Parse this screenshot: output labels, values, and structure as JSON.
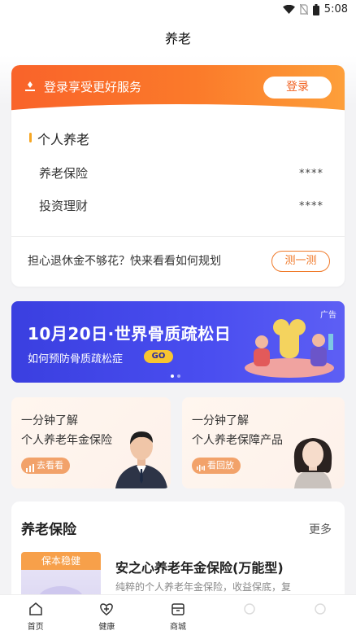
{
  "status_bar": {
    "time": "5:08"
  },
  "header": {
    "title": "养老"
  },
  "login": {
    "text": "登录享受更好服务",
    "button": "登录"
  },
  "personal": {
    "title": "个人养老",
    "rows": [
      {
        "label": "养老保险",
        "value": "****"
      },
      {
        "label": "投资理财",
        "value": "****"
      }
    ],
    "worry_text": "担心退休金不够花？快来看看如何规划",
    "test_button": "测一测"
  },
  "banner": {
    "title": "10月20日·世界骨质疏松日",
    "subtitle": "如何预防骨质疏松症",
    "go": "GO",
    "ad": "广告"
  },
  "cards": [
    {
      "line1": "一分钟了解",
      "line2": "个人养老年金保险",
      "button": "去看看",
      "icon": "bar-chart-icon"
    },
    {
      "line1": "一分钟了解",
      "line2": "个人养老保障产品",
      "button": "看回放",
      "icon": "sound-wave-icon"
    }
  ],
  "insurance": {
    "title": "养老保险",
    "more": "更多",
    "tag": "保本稳健",
    "product_name": "安之心养老年金保险(万能型)",
    "product_desc": "纯粹的个人养老年金保险，收益保底，复"
  },
  "nav": [
    {
      "label": "首页",
      "icon": "home-icon"
    },
    {
      "label": "健康",
      "icon": "health-icon"
    },
    {
      "label": "商城",
      "icon": "shop-icon"
    },
    {
      "label": "",
      "icon": "faded-icon"
    },
    {
      "label": "",
      "icon": "faded-icon"
    }
  ],
  "colors": {
    "accent": "#f9632a",
    "banner": "#3a3fe0",
    "go": "#f7c531"
  }
}
